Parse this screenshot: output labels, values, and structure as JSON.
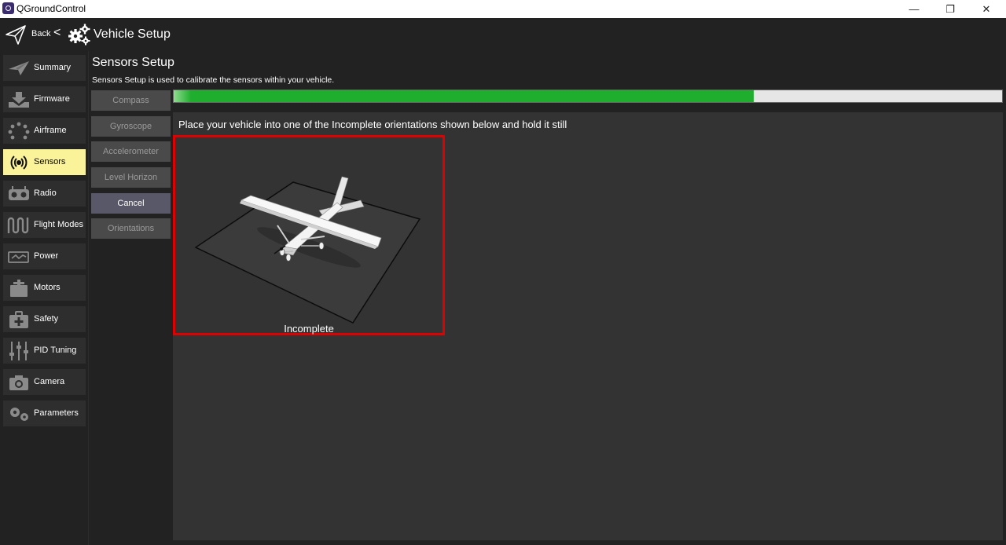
{
  "window": {
    "title": "QGroundControl",
    "controls": [
      "—",
      "❐",
      "✕"
    ]
  },
  "toolbar": {
    "back_label": "Back",
    "separator": "<",
    "title": "Vehicle Setup"
  },
  "sidebar": {
    "items": [
      {
        "label": "Summary",
        "icon": "paper-plane-icon"
      },
      {
        "label": "Firmware",
        "icon": "download-icon"
      },
      {
        "label": "Airframe",
        "icon": "airframe-icon"
      },
      {
        "label": "Sensors",
        "icon": "sensors-icon",
        "active": true
      },
      {
        "label": "Radio",
        "icon": "radio-icon"
      },
      {
        "label": "Flight Modes",
        "icon": "flight-modes-icon"
      },
      {
        "label": "Power",
        "icon": "power-icon"
      },
      {
        "label": "Motors",
        "icon": "motors-icon"
      },
      {
        "label": "Safety",
        "icon": "safety-icon"
      },
      {
        "label": "PID Tuning",
        "icon": "pid-tuning-icon"
      },
      {
        "label": "Camera",
        "icon": "camera-icon"
      },
      {
        "label": "Parameters",
        "icon": "parameters-icon"
      }
    ]
  },
  "main": {
    "title": "Sensors Setup",
    "description": "Sensors Setup is used to calibrate the sensors within your vehicle.",
    "buttons": [
      {
        "label": "Compass",
        "enabled": false
      },
      {
        "label": "Gyroscope",
        "enabled": false
      },
      {
        "label": "Accelerometer",
        "enabled": false
      },
      {
        "label": "Level Horizon",
        "enabled": false
      },
      {
        "label": "Cancel",
        "enabled": true
      },
      {
        "label": "Orientations",
        "enabled": false
      }
    ],
    "progress": 0.7,
    "instruction": "Place your vehicle into one of the Incomplete orientations shown below and hold it still",
    "orientation": {
      "status": "Incomplete",
      "highlight_color": "#e00000"
    }
  },
  "colors": {
    "active_sidebar": "#fbf39a",
    "progress": "#1fae2e",
    "background": "#222222",
    "panel": "#333333"
  }
}
